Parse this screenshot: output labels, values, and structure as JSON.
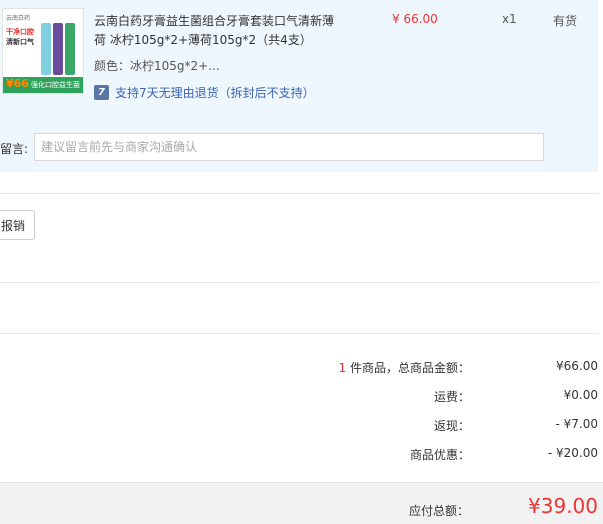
{
  "item": {
    "thumb": {
      "brand": "云南白药",
      "headline1": "干净口腔",
      "headline2": "清新口气",
      "price_tag": "¥66",
      "band_text": "强化口腔益生菌"
    },
    "title": "云南白药牙膏益生菌组合牙膏套装口气清新薄荷 冰柠105g*2+薄荷105g*2（共4支）",
    "unit_price": "¥ 66.00",
    "quantity": "x1",
    "stock": "有货",
    "color_label": "颜色：",
    "color_value": "冰柠105g*2+...",
    "return_policy": "支持7天无理由退货（拆封后不支持）",
    "return_icon": "7"
  },
  "message": {
    "label": "留言:",
    "placeholder": "建议留言前先与商家沟通确认"
  },
  "reimburse_label": "报销",
  "summary": {
    "count": "1",
    "count_suffix": "件商品，总商品金额：",
    "goods_amount": "¥66.00",
    "shipping_label": "运费：",
    "shipping": "¥0.00",
    "cashback_label": "返现：",
    "cashback": "- ¥7.00",
    "discount_label": "商品优惠：",
    "discount": "- ¥20.00",
    "total_label": "应付总额：",
    "total": "¥39.00"
  },
  "colors": {
    "accent": "#e33333",
    "panel_bg": "#eef7fd",
    "link": "#3a63b5"
  }
}
